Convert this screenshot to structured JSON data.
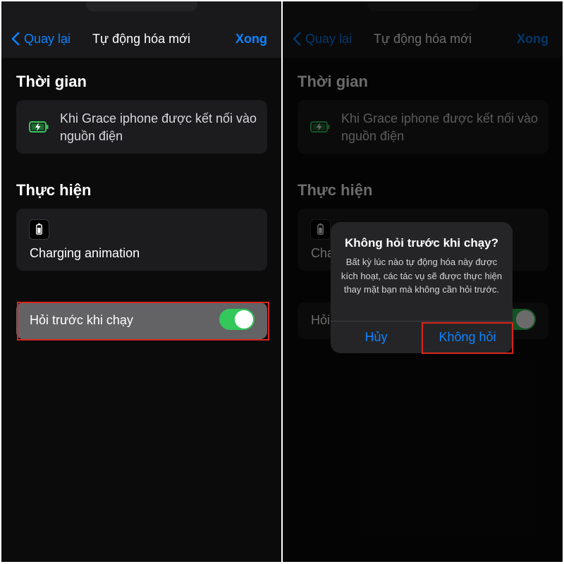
{
  "nav": {
    "back_label": "Quay lại",
    "title": "Tự động hóa mới",
    "done_label": "Xong"
  },
  "sections": {
    "when_title": "Thời gian",
    "do_title": "Thực hiện"
  },
  "trigger": {
    "icon": "battery-charging-icon",
    "text": "Khi Grace iphone được kết nối vào nguồn điện"
  },
  "action": {
    "icon": "battery-icon",
    "label": "Charging animation"
  },
  "ask_before_running": {
    "label": "Hỏi trước khi chạy",
    "enabled": true
  },
  "alert": {
    "title": "Không hỏi trước khi chạy?",
    "message": "Bất kỳ lúc nào tự động hóa này được kích hoạt, các tác vụ sẽ được thực hiện thay mặt bạn mà không cần hỏi trước.",
    "cancel_label": "Hủy",
    "confirm_label": "Không hỏi"
  },
  "colors": {
    "accent": "#0a84ff",
    "toggle_on": "#34c759",
    "highlight_border": "#d9251d"
  }
}
